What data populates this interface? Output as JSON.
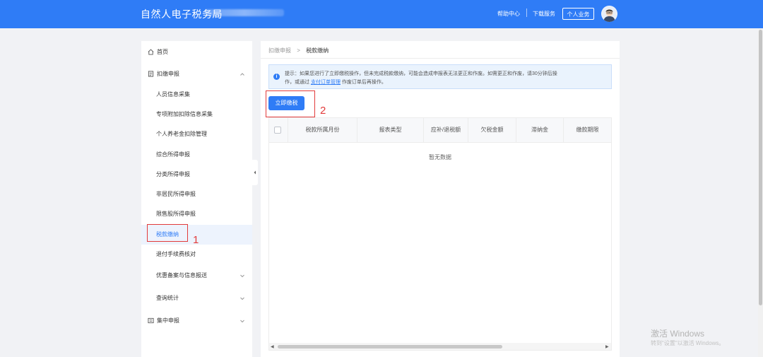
{
  "header": {
    "title": "自然人电子税务局",
    "links": [
      "帮助中心",
      "下载服务"
    ],
    "personal_button": "个人业务"
  },
  "sidebar": {
    "items": [
      {
        "label": "首页"
      },
      {
        "label": "扣缴申报"
      },
      {
        "label": "人员信息采集"
      },
      {
        "label": "专项附加扣除信息采集"
      },
      {
        "label": "个人养老金扣除管理"
      },
      {
        "label": "综合所得申报"
      },
      {
        "label": "分类所得申报"
      },
      {
        "label": "非居民所得申报"
      },
      {
        "label": "限售股所得申报"
      },
      {
        "label": "税款缴纳"
      },
      {
        "label": "退付手续费核对"
      },
      {
        "label": "优惠备案与信息报送"
      },
      {
        "label": "查询统计"
      },
      {
        "label": "集中申报"
      }
    ]
  },
  "breadcrumb": {
    "parent": "扣缴申报",
    "separator": ">",
    "current": "税款缴纳"
  },
  "notice": {
    "icon": "i",
    "line1": "提示：如果您进行了立即缴税操作，但未完成税款缴纳，可能会造成申报表无法更正和作废。如需更正和作废，请30分钟后操",
    "line2_pre": "作，或通过",
    "line2_link": "支付订单管理",
    "line2_post": "作废订单后再操作。"
  },
  "pay_button": "立即缴税",
  "table": {
    "columns": [
      "税款所属月份",
      "报表类型",
      "应补/退税额",
      "欠税金额",
      "滞纳金",
      "缴款期限"
    ],
    "empty_text": "暂无数据"
  },
  "annotations": [
    "1",
    "2"
  ],
  "watermark": {
    "line1": "激活 Windows",
    "line2": "转到\"设置\"以激活 Windows。"
  },
  "colors": {
    "primary": "#2f7cf6",
    "annotation": "#e23b3b"
  }
}
